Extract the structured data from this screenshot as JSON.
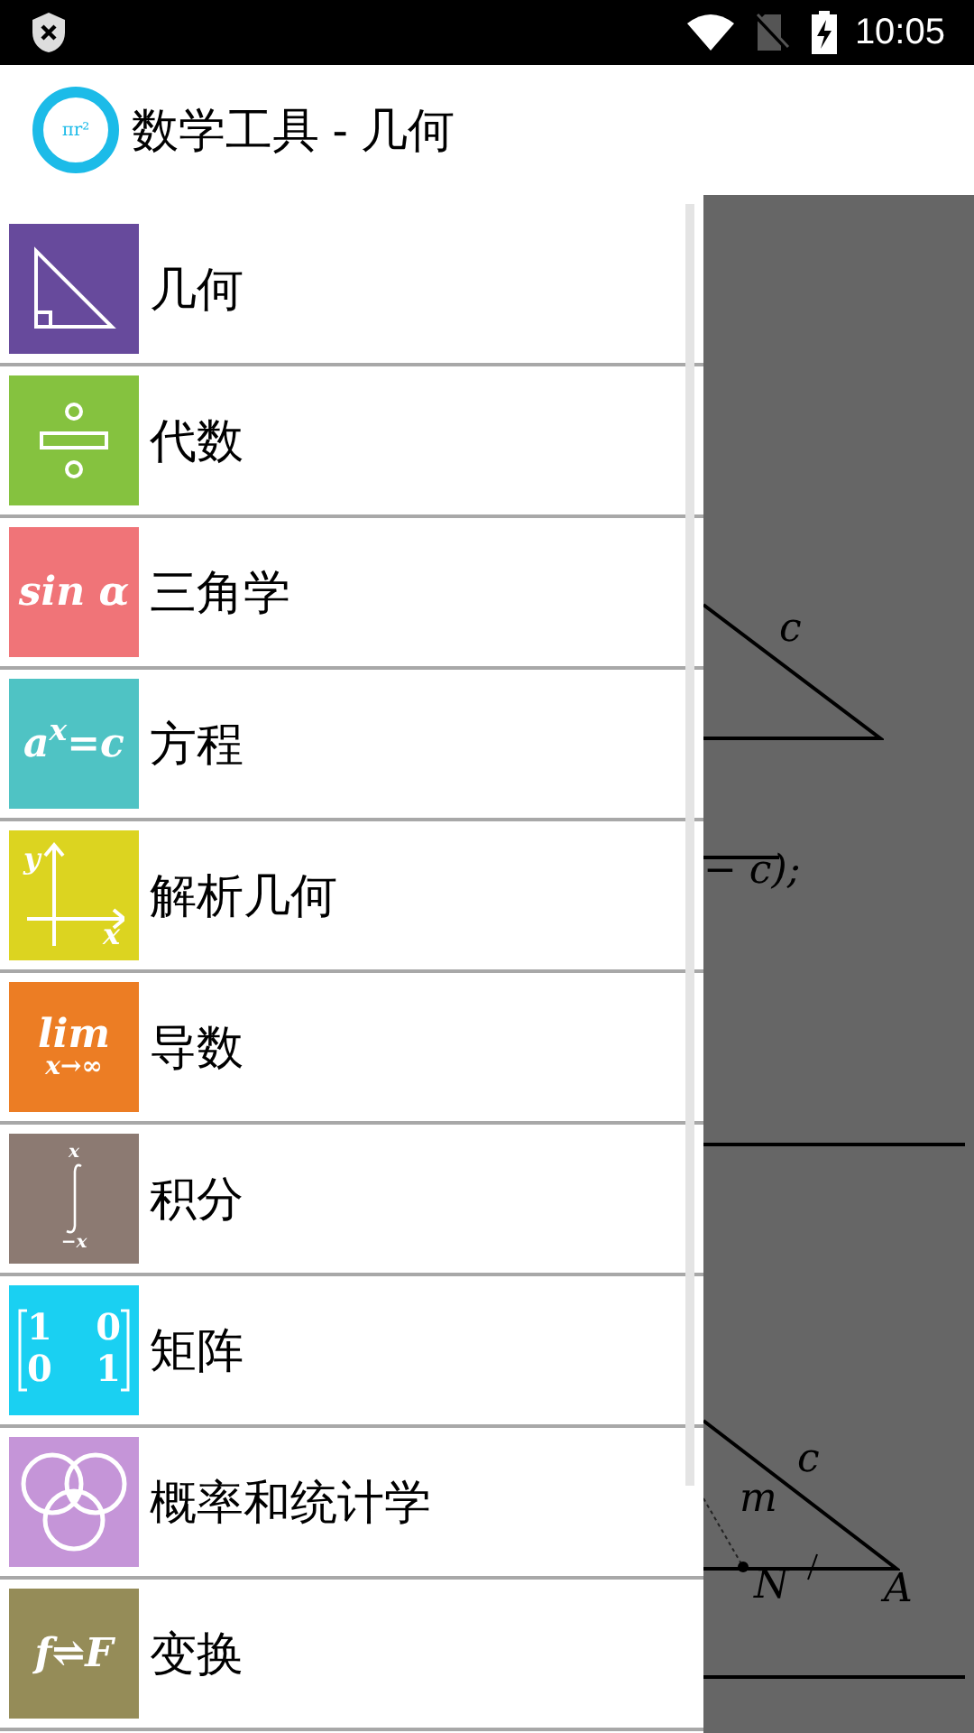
{
  "status_bar": {
    "time": "10:05"
  },
  "app_bar": {
    "logo_text": "πr²",
    "title": "数学工具 - 几何"
  },
  "drawer": {
    "items": [
      {
        "label": "几何",
        "color": "#674a9c",
        "kind": "triangle"
      },
      {
        "label": "代数",
        "color": "#85c23f",
        "kind": "divide"
      },
      {
        "label": "三角学",
        "color": "#f07478",
        "kind": "formula",
        "icon_text": "sin α"
      },
      {
        "label": "方程",
        "color": "#4fc3c4",
        "kind": "formula",
        "icon_text": "a$^{x}$=c"
      },
      {
        "label": "解析几何",
        "color": "#dcd420",
        "kind": "axes",
        "icon_texts": [
          "y",
          "x"
        ]
      },
      {
        "label": "导数",
        "color": "#ec7d24",
        "kind": "limit",
        "icon_texts": [
          "lim",
          "x→∞"
        ]
      },
      {
        "label": "积分",
        "color": "#8c7a72",
        "kind": "integral",
        "icon_texts": [
          "x",
          "−x"
        ]
      },
      {
        "label": "矩阵",
        "color": "#1ad0f2",
        "kind": "matrix",
        "icon_texts": [
          "1",
          "0",
          "0",
          "1"
        ]
      },
      {
        "label": "概率和统计学",
        "color": "#c595d8",
        "kind": "venn"
      },
      {
        "label": "变换",
        "color": "#958c58",
        "kind": "formula",
        "icon_text": "f⇌F"
      }
    ]
  },
  "background_content": {
    "labels": [
      "c",
      "− c);",
      "c",
      "m",
      "N",
      "A"
    ]
  }
}
